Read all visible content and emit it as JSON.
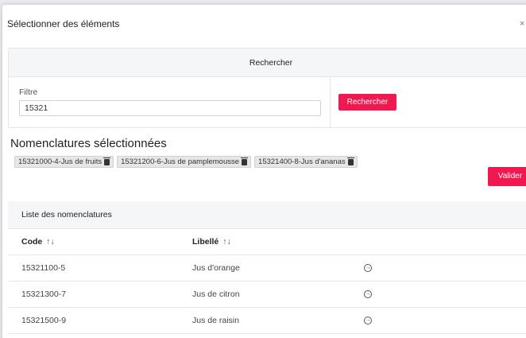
{
  "dialog": {
    "title": "Sélectionner des éléments",
    "close_glyph": "×"
  },
  "search": {
    "header": "Rechercher",
    "filter_label": "Filtre",
    "filter_value": "15321",
    "button_label": "Rechercher"
  },
  "selected": {
    "title": "Nomenclatures sélectionnées",
    "chips": [
      {
        "label": "15321000-4-Jus de fruits"
      },
      {
        "label": "15321200-6-Jus de pamplemousse"
      },
      {
        "label": "15321400-8-Jus d'ananas"
      }
    ],
    "validate_label": "Valider"
  },
  "list": {
    "title": "Liste des nomenclatures",
    "columns": {
      "code": "Code",
      "libelle": "Libellé",
      "sort_glyph": "↑↓"
    },
    "rows": [
      {
        "code": "15321100-5",
        "libelle": "Jus d'orange",
        "action_glyph": "→"
      },
      {
        "code": "15321300-7",
        "libelle": "Jus de citron",
        "action_glyph": "→"
      },
      {
        "code": "15321500-9",
        "libelle": "Jus de raisin",
        "action_glyph": "→"
      }
    ]
  },
  "colors": {
    "accent": "#f0184e"
  }
}
